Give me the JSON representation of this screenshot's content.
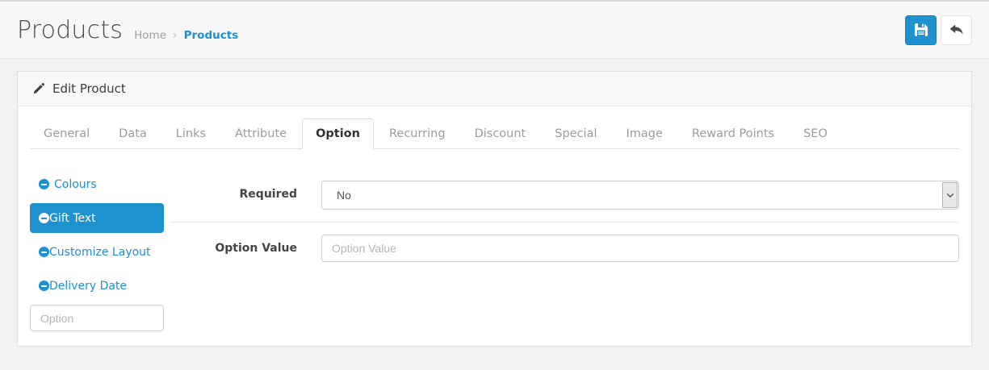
{
  "page": {
    "title": "Products"
  },
  "breadcrumb": {
    "home": "Home",
    "separator": "›",
    "current": "Products"
  },
  "toolbar": {
    "save_icon": "floppy-disk-icon",
    "back_icon": "reply-arrow-icon"
  },
  "panel": {
    "title": "Edit Product",
    "title_icon": "pencil-icon"
  },
  "tabs": [
    {
      "label": "General",
      "active": false
    },
    {
      "label": "Data",
      "active": false
    },
    {
      "label": "Links",
      "active": false
    },
    {
      "label": "Attribute",
      "active": false
    },
    {
      "label": "Option",
      "active": true
    },
    {
      "label": "Recurring",
      "active": false
    },
    {
      "label": "Discount",
      "active": false
    },
    {
      "label": "Special",
      "active": false
    },
    {
      "label": "Image",
      "active": false
    },
    {
      "label": "Reward Points",
      "active": false
    },
    {
      "label": "SEO",
      "active": false
    }
  ],
  "option_nav": {
    "item_icon": "minus-circle-icon",
    "items": [
      {
        "label": "Colours",
        "active": false
      },
      {
        "label": "Gift Text",
        "active": true
      },
      {
        "label": "Customize Layout",
        "active": false
      },
      {
        "label": "Delivery Date",
        "active": false
      }
    ],
    "autocomplete_placeholder": "Option"
  },
  "form": {
    "required": {
      "label": "Required",
      "value": "No"
    },
    "option_value": {
      "label": "Option Value",
      "placeholder": "Option Value"
    }
  },
  "colors": {
    "accent": "#1e91cf",
    "page_background": "#f1f1f1",
    "panel_heading_background": "#f8f8f8"
  }
}
